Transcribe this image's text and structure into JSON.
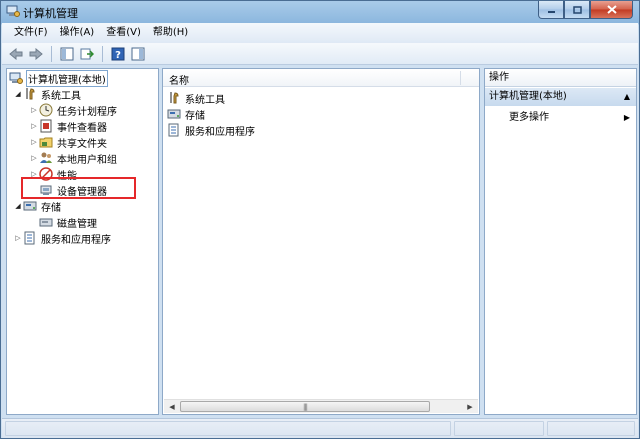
{
  "window": {
    "title": "计算机管理"
  },
  "menu": [
    {
      "label": "文件(F)"
    },
    {
      "label": "操作(A)"
    },
    {
      "label": "查看(V)"
    },
    {
      "label": "帮助(H)"
    }
  ],
  "tree": {
    "root": "计算机管理(本地)",
    "system_tools": "系统工具",
    "task_scheduler": "任务计划程序",
    "event_viewer": "事件查看器",
    "shared_folders": "共享文件夹",
    "local_users": "本地用户和组",
    "performance": "性能",
    "device_manager": "设备管理器",
    "storage": "存储",
    "disk_management": "磁盘管理",
    "services": "服务和应用程序"
  },
  "list": {
    "column_name": "名称",
    "items": [
      "系统工具",
      "存储",
      "服务和应用程序"
    ]
  },
  "actions": {
    "header": "操作",
    "section": "计算机管理(本地)",
    "more": "更多操作"
  },
  "colors": {
    "highlight": "#e5282a",
    "accent": "#8cb7de"
  }
}
